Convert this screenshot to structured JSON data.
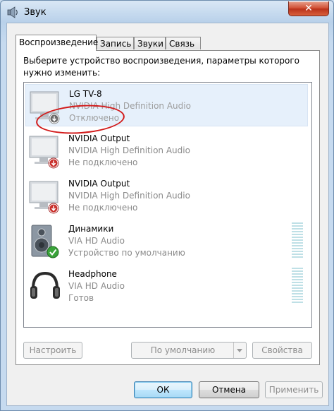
{
  "window": {
    "title": "Звук",
    "close_glyph": "✕"
  },
  "tabs": [
    {
      "label": "Воспроизведение",
      "active": true
    },
    {
      "label": "Запись",
      "active": false
    },
    {
      "label": "Звуки",
      "active": false
    },
    {
      "label": "Связь",
      "active": false
    }
  ],
  "instructions": "Выберите устройство воспроизведения, параметры которого нужно изменить:",
  "devices": [
    {
      "name": "LG TV-8",
      "driver": "NVIDIA High Definition Audio",
      "status": "Отключено",
      "icon": "monitor-icon",
      "badge": "disabled-down-arrow-icon",
      "selected": true
    },
    {
      "name": "NVIDIA Output",
      "driver": "NVIDIA High Definition Audio",
      "status": "Не подключено",
      "icon": "monitor-icon",
      "badge": "disconnected-down-arrow-icon",
      "selected": false
    },
    {
      "name": "NVIDIA Output",
      "driver": "NVIDIA High Definition Audio",
      "status": "Не подключено",
      "icon": "monitor-icon",
      "badge": "disconnected-down-arrow-icon",
      "selected": false
    },
    {
      "name": "Динамики",
      "driver": "VIA HD Audio",
      "status": "Устройство по умолчанию",
      "icon": "speaker-icon",
      "badge": "default-check-icon",
      "selected": false
    },
    {
      "name": "Headphone",
      "driver": "VIA HD Audio",
      "status": "Готов",
      "icon": "headphones-icon",
      "badge": "",
      "selected": false
    }
  ],
  "buttons": {
    "configure": "Настроить",
    "set_default": "По умолчанию",
    "properties": "Свойства",
    "ok": "ОК",
    "cancel": "Отмена",
    "apply": "Применить"
  },
  "colors": {
    "accent_red": "#d21919",
    "check_green": "#3aa33a",
    "badge_red": "#c9302c"
  }
}
